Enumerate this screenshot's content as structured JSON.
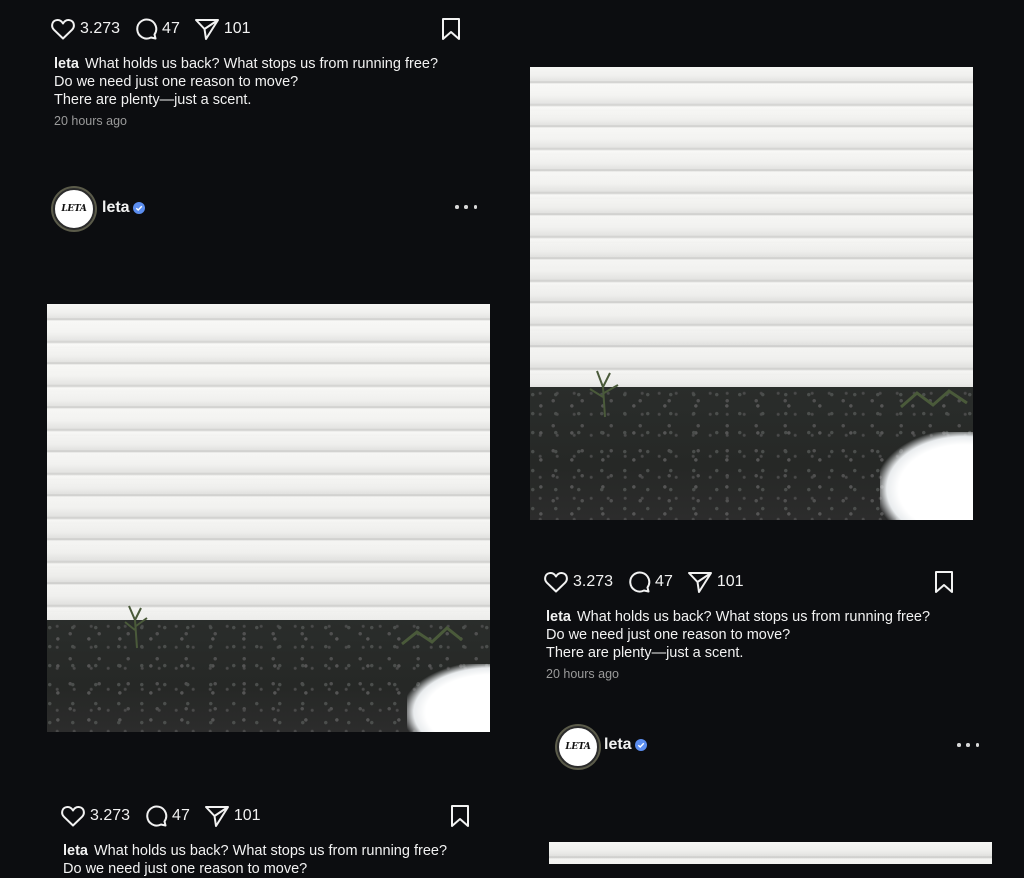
{
  "posts": [
    {
      "likes": "3.273",
      "comments": "47",
      "shares": "101",
      "caption_user": "leta",
      "caption_lines": [
        "What holds us back? What stops us from running free?",
        "Do we need just one reason to move?",
        "There are plenty—just a scent."
      ],
      "time": "20 hours ago"
    },
    {
      "avatar_text": "LETA",
      "username": "leta",
      "likes": "3.273",
      "comments": "47",
      "shares": "101",
      "caption_user": "leta",
      "caption_lines": [
        "What holds us back? What stops us from running free?",
        "Do we need just one reason to move?"
      ]
    },
    {
      "likes": "3.273",
      "comments": "47",
      "shares": "101",
      "caption_user": "leta",
      "caption_lines": [
        "What holds us back? What stops us from running free?",
        "Do we need just one reason to move?",
        "There are plenty—just a scent."
      ],
      "time": "20 hours ago"
    },
    {
      "avatar_text": "LETA",
      "username": "leta"
    }
  ],
  "icons": {
    "like": "heart-icon",
    "comment": "comment-icon",
    "share": "send-icon",
    "save": "bookmark-icon",
    "verified": "verified-badge-icon",
    "more": "more-options-icon"
  },
  "colors": {
    "background": "#0c0d10",
    "verified": "#5b8def",
    "text": "#f2f2f2",
    "muted": "#9a9a9a"
  }
}
